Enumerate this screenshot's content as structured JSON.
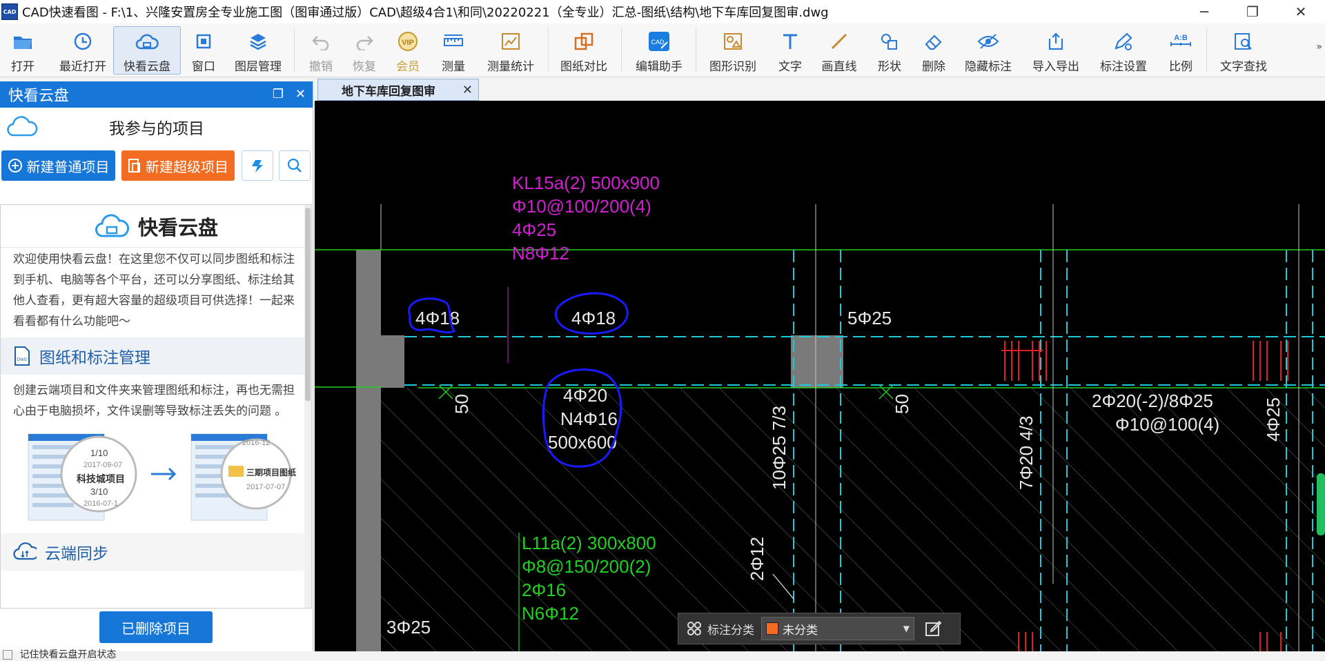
{
  "window": {
    "title": "CAD快速看图 - F:\\1、兴隆安置房全专业施工图（图审通过版）CAD\\超级4合1\\和同\\20220221（全专业）汇总-图纸\\结构\\地下车库回复图审.dwg",
    "app_icon_text": "CAD",
    "minimize": "─",
    "restore": "❐",
    "close": "✕"
  },
  "toolbar": {
    "items": [
      {
        "label": "打开",
        "icon": "folder-icon"
      },
      {
        "label": "最近打开",
        "icon": "clock-icon"
      },
      {
        "label": "快看云盘",
        "icon": "cloud-icon"
      },
      {
        "label": "窗口",
        "icon": "window-icon"
      },
      {
        "label": "图层管理",
        "icon": "layers-icon"
      },
      {
        "label": "撤销",
        "icon": "undo-icon"
      },
      {
        "label": "恢复",
        "icon": "redo-icon"
      },
      {
        "label": "会员",
        "icon": "vip-icon"
      },
      {
        "label": "测量",
        "icon": "ruler-icon"
      },
      {
        "label": "测量统计",
        "icon": "measure-stats-icon"
      },
      {
        "label": "图纸对比",
        "icon": "compare-icon"
      },
      {
        "label": "编辑助手",
        "icon": "edit-assistant-icon"
      },
      {
        "label": "图形识别",
        "icon": "shape-recognize-icon"
      },
      {
        "label": "文字",
        "icon": "text-icon"
      },
      {
        "label": "画直线",
        "icon": "line-icon"
      },
      {
        "label": "形状",
        "icon": "shapes-icon"
      },
      {
        "label": "删除",
        "icon": "eraser-icon"
      },
      {
        "label": "隐藏标注",
        "icon": "eye-hide-icon"
      },
      {
        "label": "导入导出",
        "icon": "import-export-icon"
      },
      {
        "label": "标注设置",
        "icon": "annotation-settings-icon"
      },
      {
        "label": "比例",
        "icon": "scale-icon"
      },
      {
        "label": "文字查找",
        "icon": "text-search-icon"
      }
    ],
    "vip_text": "VIP",
    "scale_text": "A:B",
    "edit_text": "CAD",
    "more": "»"
  },
  "panel": {
    "title": "快看云盘",
    "restore_icon": "❐",
    "close_icon": "✕",
    "project_title": "我参与的项目",
    "new_normal": "新建普通项目",
    "new_super": "新建超级项目",
    "intro": {
      "heading": "快看云盘",
      "text1": "欢迎使用快看云盘！在这里您不仅可以同步图纸和标注到手机、电脑等各个平台，还可以分享图纸、标注给其他人查看，更有超大容量的超级项目可供选择！一起来看看都有什么功能吧～",
      "section1": "图纸和标注管理",
      "text2": "创建云端项目和文件夹来管理图纸和标注，再也无需担心由于电脑损坏，文件误删等导致标注丢失的问题 。",
      "img_left": {
        "label1": "1/10",
        "date1": "2017-09-07",
        "name": "科技城项目",
        "label2": "3/10",
        "date2": "2016-07-1"
      },
      "img_right": {
        "date_top": "2016-12",
        "name": "三期项目图纸",
        "date": "2017-07-07"
      },
      "section2": "云端同步",
      "dwg_badge": "DWG"
    },
    "deleted_projects": "已删除项目",
    "checkbox_label": "记住快看云盘开启状态"
  },
  "doc_tab": {
    "label": "地下车库回复图审",
    "close": "✕"
  },
  "annotation_bar": {
    "label": "标注分类",
    "category": "未分类",
    "swatch_color": "#f26d21",
    "caret": "▼"
  },
  "cad": {
    "magenta_notes": [
      "KL15a(2) 500x900",
      "Φ10@100/200(4)",
      "4Φ25",
      "N8Φ12"
    ],
    "green_notes": [
      "L11a(2) 300x800",
      "Φ8@150/200(2)",
      "2Φ16",
      "N6Φ12"
    ],
    "circled": [
      "4Φ18",
      "4Φ18"
    ],
    "circled_block": [
      "4Φ20",
      "N4Φ16",
      "500x600"
    ],
    "text_5phi25": "5Φ25",
    "dim_50a": "50",
    "dim_50b": "50",
    "vert_1": "10Φ25 7/3",
    "vert_2": "7Φ20 4/3",
    "vert_3": "4Φ25",
    "vert_4": "2Φ12",
    "right_note_1": "2Φ20(-2)/8Φ25",
    "right_note_2": "Φ10@100(4)",
    "bottom_left": "3Φ25",
    "colors": {
      "magenta": "#d020d0",
      "green": "#20d020",
      "cyan": "#20c8d8",
      "white": "#e8e8e8",
      "blue_ink": "#1a1aff",
      "red": "#e02020"
    }
  }
}
